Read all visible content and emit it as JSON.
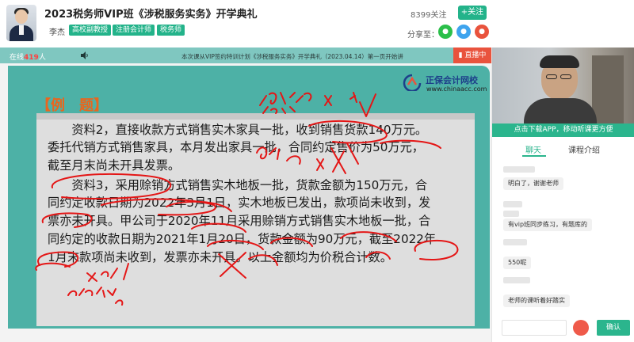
{
  "header": {
    "course_title": "2023税务师VIP班《涉税服务实务》开学典礼",
    "teacher": "李杰",
    "tags": [
      "高校副教授",
      "注册会计师",
      "税务师"
    ],
    "follow_count": "8399关注",
    "follow_button": "+关注",
    "share_label": "分享至："
  },
  "live_bar": {
    "online_prefix": "在线",
    "online_count": "419",
    "online_suffix": "人",
    "info": "本次课从VIP签约特训计划《涉税服务实务》开学典礼（2023.04.14）第一页开始讲",
    "badge": "直播中"
  },
  "slide": {
    "exam_label": "【例　题】",
    "logo_name": "正保会计网校",
    "logo_url": "www.chinaacc.com",
    "lines": [
      "　　资料2，直接收款方式销售实木家具一批，收到销售货款140万元。",
      "委托代销方式销售家具，本月发出家具一批，合同约定售价为50万元，",
      "截至月末尚未开具发票。",
      "　　资料3，采用赊销方式销售实木地板一批，货款金额为150万元，合",
      "同约定收款日期为2022年3月1日，实木地板已发出，款项尚未收到，发",
      "票亦未开具。甲公司于2020年11月采用赊销方式销售实木地板一批，合",
      "同约定的收款日期为2021年1月20日，货款金额为90万元，截至2022年",
      "1月末款项尚未收到，发票亦未开具。以上金额均为价税合计数。"
    ]
  },
  "right_panel": {
    "banner": "点击下载APP，移动听课更方便",
    "tabs": [
      "聊天",
      "课程介绍"
    ],
    "messages": [
      "明白了，谢谢老师",
      "有vip班同步练习，有题库的",
      "550呢",
      "老师的课听着好踏实"
    ],
    "send_button": "确认"
  }
}
